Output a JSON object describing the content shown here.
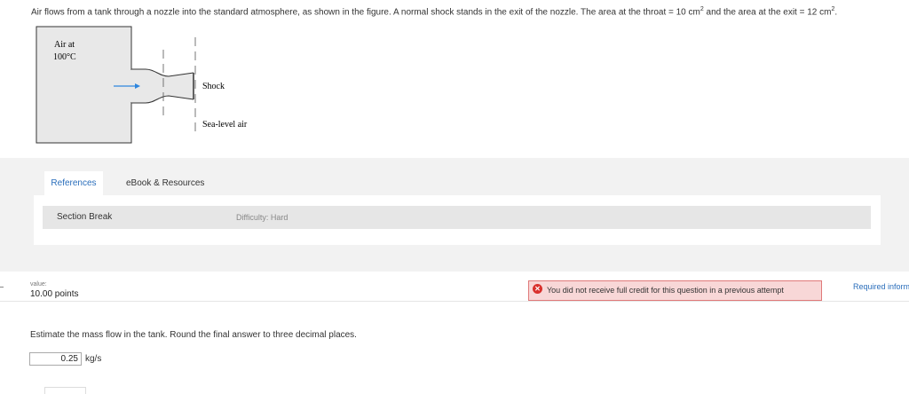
{
  "question": {
    "text_part1": "Air flows from a tank through a nozzle into the standard atmosphere, as shown in the figure. A normal shock stands in the exit of the nozzle. The area at the throat = 10 cm",
    "sup1": "2",
    "text_part2": " and the area at the exit = 12 cm",
    "sup2": "2",
    "text_part3": "."
  },
  "figure": {
    "tank_label_line1": "Air at",
    "tank_label_line2": "100°C",
    "shock_label": "Shock",
    "outlet_label": "Sea-level air",
    "arrow_color": "#2e86de"
  },
  "tabs": {
    "references": "References",
    "ebook": "eBook & Resources"
  },
  "section": {
    "label": "Section Break",
    "difficulty": "Difficulty: Hard"
  },
  "meta": {
    "value_caption": "value:",
    "points": "10.00 points",
    "credit_icon": "x-circle-icon",
    "credit_notice": "You did not receive full credit for this question in a previous attempt",
    "required_info": "Required information"
  },
  "problem": {
    "prompt": "Estimate the mass flow in the tank. Round the final answer to three decimal places.",
    "answer_value": "0.25",
    "unit": "kg/s"
  },
  "colors": {
    "accent_link": "#2a6ebb",
    "error_bg": "#f8d7d7",
    "error_border": "#e07a7a",
    "error_icon": "#d9302c"
  }
}
